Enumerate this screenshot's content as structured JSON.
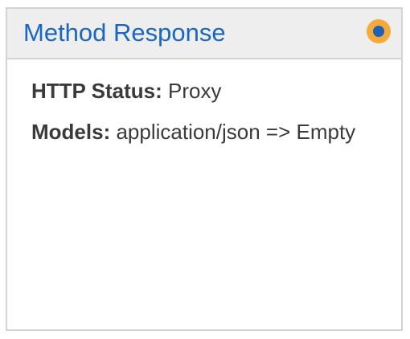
{
  "panel": {
    "title": "Method Response",
    "status_icon": "status-dot-icon",
    "status_colors": {
      "outer": "#f6a93b",
      "inner": "#1f5fb4"
    },
    "title_color": "#1a67c1"
  },
  "fields": {
    "http_status": {
      "label": "HTTP Status:",
      "value": "Proxy"
    },
    "models": {
      "label": "Models:",
      "value": "application/json => Empty"
    }
  }
}
